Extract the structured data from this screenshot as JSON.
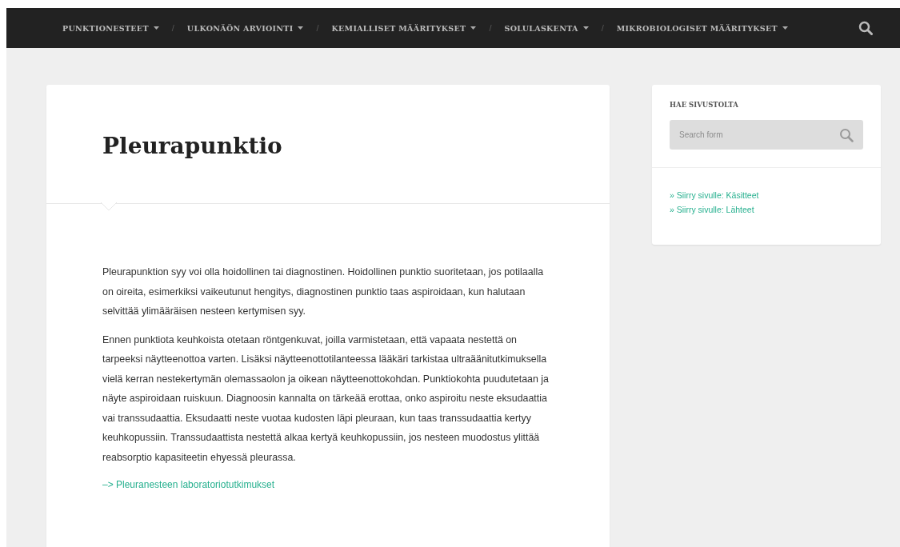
{
  "nav": {
    "items": [
      {
        "kind": "menu",
        "label": "PUNKTIONESTEET"
      },
      {
        "kind": "separator",
        "label": "/"
      },
      {
        "kind": "menu",
        "label": "ULKONÄÖN ARVIOINTI"
      },
      {
        "kind": "separator",
        "label": "/"
      },
      {
        "kind": "menu",
        "label": "KEMIALLISET MÄÄRITYKSET"
      },
      {
        "kind": "separator",
        "label": "/"
      },
      {
        "kind": "menu",
        "label": "SOLULASKENTA"
      },
      {
        "kind": "separator",
        "label": "/"
      },
      {
        "kind": "menu",
        "label": "MIKROBIOLOGISET MÄÄRITYKSET"
      }
    ]
  },
  "article": {
    "title": "Pleurapunktio",
    "paragraphs": [
      "Pleurapunktion syy voi olla hoidollinen tai diagnostinen. Hoidollinen punktio suoritetaan, jos potilaalla on oireita, esimerkiksi vaikeutunut hengitys, diagnostinen punktio taas aspiroidaan, kun halutaan selvittää ylimääräisen nesteen kertymisen syy.",
      "Ennen punktiota keuhkoista otetaan röntgenkuvat, joilla varmistetaan, että vapaata nestettä on tarpeeksi näytteenottoa varten. Lisäksi näytteenottotilanteessa lääkäri tarkistaa ultraäänitutkimuksella vielä kerran nestekertymän olemassaolon ja oikean näytteenottokohdan. Punktiokohta puudutetaan ja näyte aspiroidaan ruiskuun. Diagnoosin kannalta on tärkeää erottaa, onko aspiroitu neste eksudaattia vai transsudaattia. Eksudaatti neste vuotaa kudosten läpi pleuraan, kun taas transsudaattia kertyy keuhkopussiin. Transsudaattista nestettä alkaa kertyä keuhkopussiin, jos nesteen muodostus ylittää reabsorptio kapasiteetin ehyessä pleurassa."
    ],
    "link": "–> Pleuranesteen laboratoriotutkimukset"
  },
  "sidebar": {
    "heading": "HAE SIVUSTOLTA",
    "search": {
      "placeholder": "Search form"
    },
    "links": [
      "» Siirry sivulle: Käsitteet",
      "» Siirry sivulle: Lähteet"
    ]
  }
}
